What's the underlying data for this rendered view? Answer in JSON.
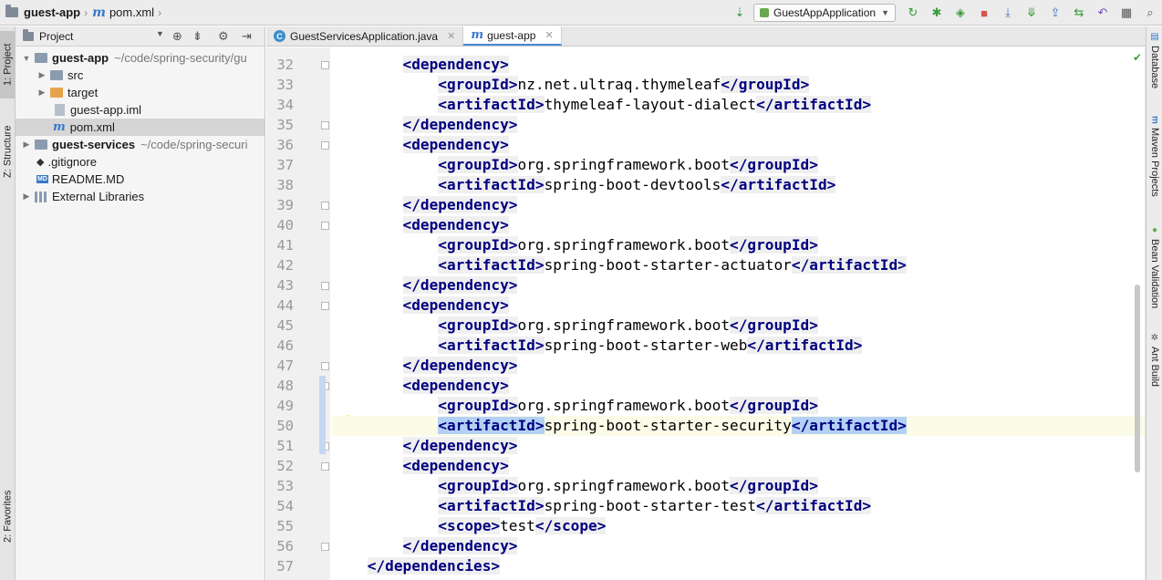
{
  "navbar": {
    "project": "guest-app",
    "file": "pom.xml",
    "run_config": "GuestAppApplication"
  },
  "left_strip": {
    "project_tab": "1: Project",
    "structure_tab": "Z: Structure",
    "favorites_tab": "2: Favorites"
  },
  "project_panel": {
    "title": "Project",
    "tree": [
      {
        "label": "guest-app",
        "path": "~/code/spring-security/gu",
        "expanded": true
      },
      {
        "label": "src"
      },
      {
        "label": "target"
      },
      {
        "label": "guest-app.iml"
      },
      {
        "label": "pom.xml"
      },
      {
        "label": "guest-services",
        "path": "~/code/spring-securi",
        "expanded": false
      },
      {
        "label": ".gitignore"
      },
      {
        "label": "README.MD",
        "badge": "MD"
      },
      {
        "label": "External Libraries"
      }
    ]
  },
  "tabs": [
    {
      "label": "GuestServicesApplication.java",
      "icon": "java-class-icon"
    },
    {
      "label": "guest-app",
      "icon": "maven-icon",
      "active": true
    }
  ],
  "editor": {
    "current_line": 50,
    "lines": [
      {
        "n": "32",
        "indent": "    ",
        "open": "<dependency>",
        "text": "",
        "close": ""
      },
      {
        "n": "33",
        "indent": "        ",
        "open": "<groupId>",
        "text": "nz.net.ultraq.thymeleaf",
        "close": "</groupId>"
      },
      {
        "n": "34",
        "indent": "        ",
        "open": "<artifactId>",
        "text": "thymeleaf-layout-dialect",
        "close": "</artifactId>"
      },
      {
        "n": "35",
        "indent": "    ",
        "open": "</dependency>",
        "text": "",
        "close": ""
      },
      {
        "n": "36",
        "indent": "    ",
        "open": "<dependency>",
        "text": "",
        "close": ""
      },
      {
        "n": "37",
        "indent": "        ",
        "open": "<groupId>",
        "text": "org.springframework.boot",
        "close": "</groupId>"
      },
      {
        "n": "38",
        "indent": "        ",
        "open": "<artifactId>",
        "text": "spring-boot-devtools",
        "close": "</artifactId>"
      },
      {
        "n": "39",
        "indent": "    ",
        "open": "</dependency>",
        "text": "",
        "close": ""
      },
      {
        "n": "40",
        "indent": "    ",
        "open": "<dependency>",
        "text": "",
        "close": ""
      },
      {
        "n": "41",
        "indent": "        ",
        "open": "<groupId>",
        "text": "org.springframework.boot",
        "close": "</groupId>"
      },
      {
        "n": "42",
        "indent": "        ",
        "open": "<artifactId>",
        "text": "spring-boot-starter-actuator",
        "close": "</artifactId>"
      },
      {
        "n": "43",
        "indent": "    ",
        "open": "</dependency>",
        "text": "",
        "close": ""
      },
      {
        "n": "44",
        "indent": "    ",
        "open": "<dependency>",
        "text": "",
        "close": ""
      },
      {
        "n": "45",
        "indent": "        ",
        "open": "<groupId>",
        "text": "org.springframework.boot",
        "close": "</groupId>"
      },
      {
        "n": "46",
        "indent": "        ",
        "open": "<artifactId>",
        "text": "spring-boot-starter-web",
        "close": "</artifactId>"
      },
      {
        "n": "47",
        "indent": "    ",
        "open": "</dependency>",
        "text": "",
        "close": ""
      },
      {
        "n": "48",
        "indent": "    ",
        "open": "<dependency>",
        "text": "",
        "close": ""
      },
      {
        "n": "49",
        "indent": "        ",
        "open": "<groupId>",
        "text": "org.springframework.boot",
        "close": "</groupId>"
      },
      {
        "n": "50",
        "indent": "        ",
        "open": "<artifactId>",
        "text": "spring-boot-starter-security",
        "close": "</artifactId>"
      },
      {
        "n": "51",
        "indent": "    ",
        "open": "</dependency>",
        "text": "",
        "close": ""
      },
      {
        "n": "52",
        "indent": "    ",
        "open": "<dependency>",
        "text": "",
        "close": ""
      },
      {
        "n": "53",
        "indent": "        ",
        "open": "<groupId>",
        "text": "org.springframework.boot",
        "close": "</groupId>"
      },
      {
        "n": "54",
        "indent": "        ",
        "open": "<artifactId>",
        "text": "spring-boot-starter-test",
        "close": "</artifactId>"
      },
      {
        "n": "55",
        "indent": "        ",
        "open": "<scope>",
        "text": "test",
        "close": "</scope>"
      },
      {
        "n": "56",
        "indent": "    ",
        "open": "</dependency>",
        "text": "",
        "close": ""
      },
      {
        "n": "57",
        "indent": "",
        "open": "</dependencies>",
        "text": "",
        "close": ""
      }
    ]
  },
  "right_strip": {
    "database": "Database",
    "maven": "Maven Projects",
    "bean": "Bean Validation",
    "ant": "Ant Build"
  }
}
